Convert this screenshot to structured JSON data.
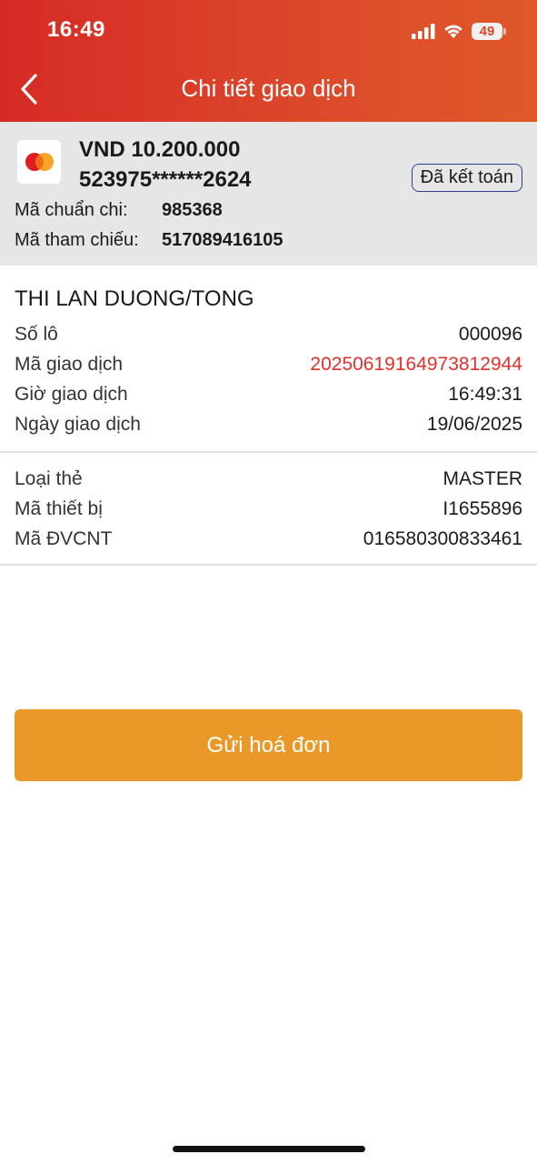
{
  "status_bar": {
    "time": "16:49",
    "battery": "49"
  },
  "header": {
    "title": "Chi tiết giao dịch"
  },
  "summary": {
    "amount": "VND 10.200.000",
    "card_number": "523975******2624",
    "status_badge": "Đã kết toán",
    "auth_code_label": "Mã chuẩn chi:",
    "auth_code_value": "985368",
    "reference_label": "Mã tham chiếu:",
    "reference_value": "517089416105"
  },
  "details": {
    "customer_name": "THI LAN DUONG/TONG",
    "rows": [
      {
        "label": "Số lô",
        "value": "000096"
      },
      {
        "label": "Mã giao dịch",
        "value": "20250619164973812944"
      },
      {
        "label": "Giờ giao dịch",
        "value": "16:49:31"
      },
      {
        "label": "Ngày giao dịch",
        "value": "19/06/2025"
      }
    ]
  },
  "device": {
    "rows": [
      {
        "label": "Loại thẻ",
        "value": "MASTER"
      },
      {
        "label": "Mã thiết bị",
        "value": "I1655896"
      },
      {
        "label": "Mã ĐVCNT",
        "value": "016580300833461"
      }
    ]
  },
  "actions": {
    "send_invoice": "Gửi hoá đơn"
  },
  "colors": {
    "header_red": "#d62a26",
    "accent_orange": "#ea9828",
    "transaction_id_red": "#e0312b",
    "badge_border": "#2b3f8f"
  },
  "icons": [
    "back-chevron-icon",
    "mastercard-logo-icon",
    "signal-icon",
    "wifi-icon",
    "battery-icon"
  ]
}
